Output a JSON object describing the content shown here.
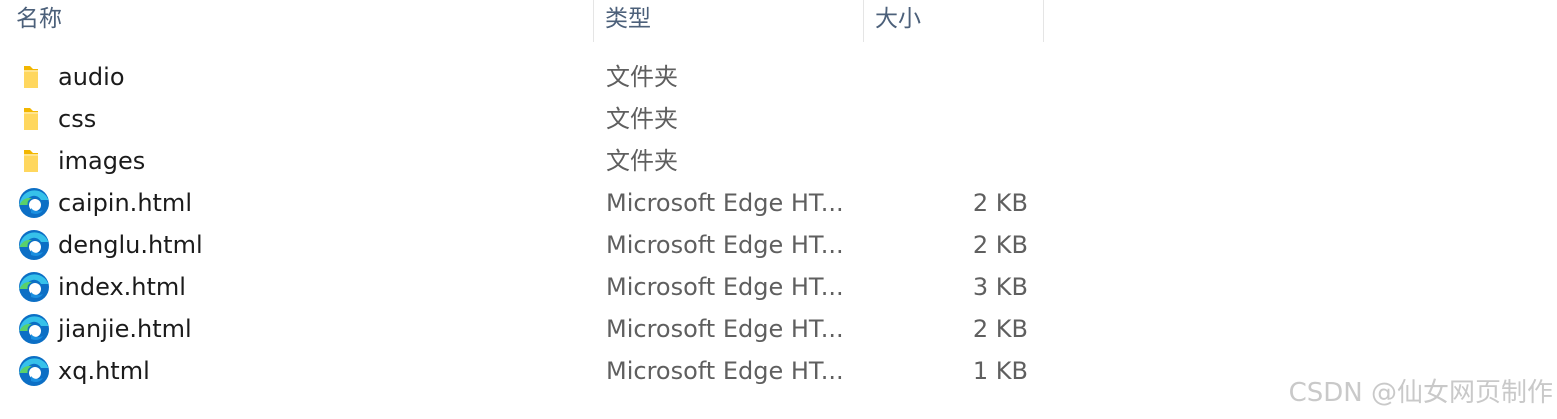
{
  "columns": {
    "name": "名称",
    "type": "类型",
    "size": "大小"
  },
  "files": [
    {
      "name": "audio",
      "type": "文件夹",
      "size": "",
      "icon": "folder-icon"
    },
    {
      "name": "css",
      "type": "文件夹",
      "size": "",
      "icon": "folder-icon"
    },
    {
      "name": "images",
      "type": "文件夹",
      "size": "",
      "icon": "folder-icon"
    },
    {
      "name": "caipin.html",
      "type": "Microsoft Edge HT...",
      "size": "2 KB",
      "icon": "edge-icon"
    },
    {
      "name": "denglu.html",
      "type": "Microsoft Edge HT...",
      "size": "2 KB",
      "icon": "edge-icon"
    },
    {
      "name": "index.html",
      "type": "Microsoft Edge HT...",
      "size": "3 KB",
      "icon": "edge-icon"
    },
    {
      "name": "jianjie.html",
      "type": "Microsoft Edge HT...",
      "size": "2 KB",
      "icon": "edge-icon"
    },
    {
      "name": "xq.html",
      "type": "Microsoft Edge HT...",
      "size": "1 KB",
      "icon": "edge-icon"
    }
  ],
  "watermark": "CSDN @仙女网页制作"
}
